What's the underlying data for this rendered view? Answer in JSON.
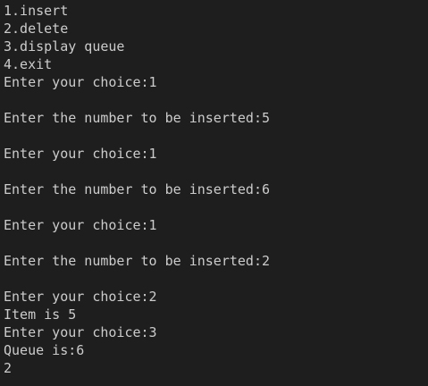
{
  "terminal": {
    "lines": [
      "1.insert",
      "2.delete",
      "3.display queue",
      "4.exit",
      "Enter your choice:1",
      "",
      "Enter the number to be inserted:5",
      "",
      "Enter your choice:1",
      "",
      "Enter the number to be inserted:6",
      "",
      "Enter your choice:1",
      "",
      "Enter the number to be inserted:2",
      "",
      "Enter your choice:2",
      "Item is 5",
      "Enter your choice:3",
      "Queue is:6",
      "2"
    ],
    "colors": {
      "background": "#1e1e1e",
      "text": "#cccccc"
    }
  }
}
